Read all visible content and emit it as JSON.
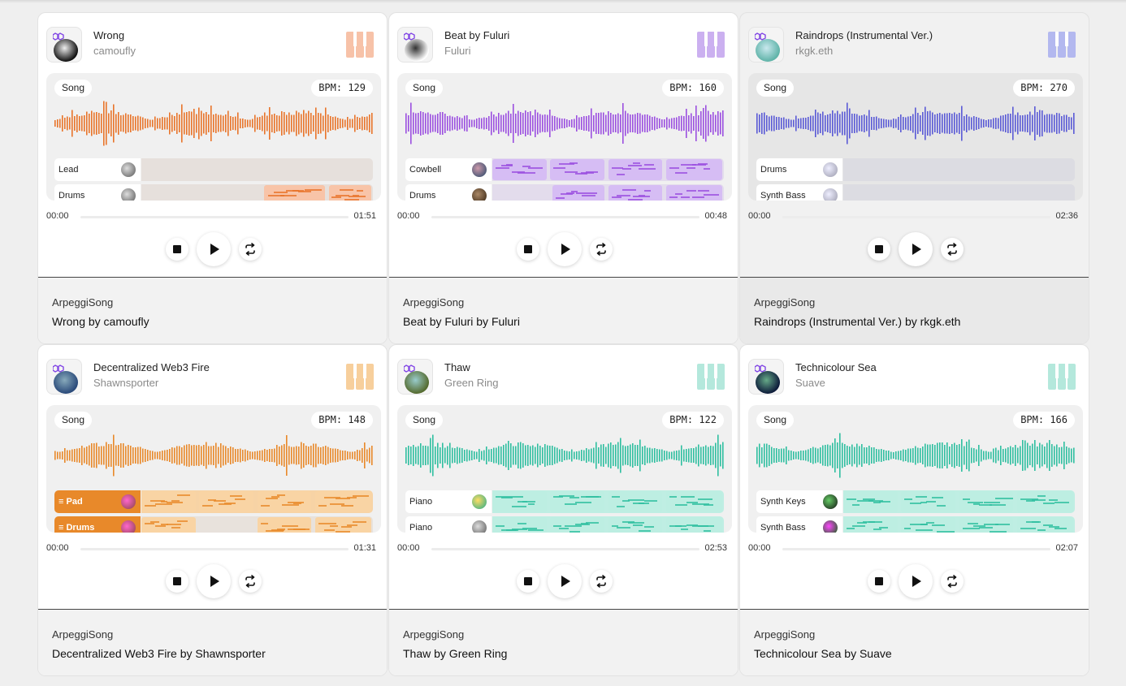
{
  "cards": [
    {
      "title": "Wrong",
      "artist": "camoufly",
      "accent": "#e8742a",
      "keys": "#f7c2a8",
      "badge": "Song",
      "bpm": "BPM: 129",
      "tracks": [
        {
          "name": "Lead",
          "icon": "avatar-gray",
          "lane": "#e6e0dc",
          "clips": []
        },
        {
          "name": "Drums",
          "icon": "avatar-gray",
          "lane": "#e6e0dc",
          "clips": [
            {
              "a": 0.53,
              "b": 0.8,
              "c": "#f8c4a8"
            },
            {
              "a": 0.81,
              "b": 1.0,
              "c": "#f8c4a8"
            }
          ]
        }
      ],
      "current": "00:00",
      "duration": "01:51",
      "kind": "ArpeggiSong",
      "full": "Wrong by camoufly",
      "dim": false,
      "pic": [
        "#111",
        "#eee"
      ]
    },
    {
      "title": "Beat by Fuluri",
      "artist": "Fuluri",
      "accent": "#9b4fe0",
      "keys": "#cbb0f0",
      "badge": "Song",
      "bpm": "BPM: 160",
      "tracks": [
        {
          "name": "Cowbell",
          "icon": "avatar-blue",
          "lane": "#e3dcec",
          "clips": [
            {
              "a": 0.0,
              "b": 0.24,
              "c": "#d6bdf4"
            },
            {
              "a": 0.25,
              "b": 0.49,
              "c": "#d6bdf4"
            },
            {
              "a": 0.5,
              "b": 0.74,
              "c": "#d6bdf4"
            },
            {
              "a": 0.75,
              "b": 1.0,
              "c": "#d6bdf4"
            }
          ]
        },
        {
          "name": "Drums",
          "icon": "avatar-brown",
          "lane": "#e3dcec",
          "clips": [
            {
              "a": 0.26,
              "b": 0.49,
              "c": "#d6bdf4"
            },
            {
              "a": 0.5,
              "b": 0.74,
              "c": "#d6bdf4"
            },
            {
              "a": 0.75,
              "b": 1.0,
              "c": "#d6bdf4"
            }
          ]
        }
      ],
      "current": "00:00",
      "duration": "00:48",
      "kind": "ArpeggiSong",
      "full": "Beat by Fuluri by Fuluri",
      "dim": false,
      "pic": [
        "#fff",
        "#333"
      ]
    },
    {
      "title": "Raindrops (Instrumental Ver.)",
      "artist": "rkgk.eth",
      "accent": "#5a5ad6",
      "keys": "#b3b8ef",
      "badge": "Song",
      "bpm": "BPM: 270",
      "tracks": [
        {
          "name": "Drums",
          "icon": "avatar-mic",
          "lane": "#dcdce2",
          "clips": []
        },
        {
          "name": "Synth Bass",
          "icon": "avatar-mic",
          "lane": "#dcdce2",
          "clips": []
        }
      ],
      "current": "00:00",
      "duration": "02:36",
      "kind": "ArpeggiSong",
      "full": "Raindrops (Instrumental Ver.) by rkgk.eth",
      "dim": true,
      "pic": [
        "#5fb3a8",
        "#c9e8ee"
      ]
    },
    {
      "title": "Decentralized Web3 Fire",
      "artist": "Shawnsporter",
      "accent": "#e8892a",
      "keys": "#f7cf9c",
      "badge": "Song",
      "bpm": "BPM: 148",
      "tracks": [
        {
          "name": "Pad",
          "icon": "avatar-pair",
          "lane": "#f7d3a5",
          "active": true,
          "clips": [
            {
              "a": 0.0,
              "b": 0.24,
              "c": "#f9d4a4"
            },
            {
              "a": 0.25,
              "b": 0.49,
              "c": "#f9d4a4"
            },
            {
              "a": 0.5,
              "b": 0.74,
              "c": "#f9d4a4"
            },
            {
              "a": 0.75,
              "b": 1.0,
              "c": "#f9d4a4"
            }
          ]
        },
        {
          "name": "Drums",
          "icon": "avatar-pair",
          "lane": "#e8e2dc",
          "active": true,
          "clips": [
            {
              "a": 0.0,
              "b": 0.24,
              "c": "#f9d4a4"
            },
            {
              "a": 0.5,
              "b": 0.74,
              "c": "#f9d4a4"
            },
            {
              "a": 0.75,
              "b": 1.0,
              "c": "#f9d4a4"
            }
          ]
        }
      ],
      "current": "00:00",
      "duration": "01:31",
      "kind": "ArpeggiSong",
      "full": "Decentralized Web3 Fire by Shawnsporter",
      "dim": false,
      "pic": [
        "#2a4a7a",
        "#8ab"
      ]
    },
    {
      "title": "Thaw",
      "artist": "Green Ring",
      "accent": "#2fbfa0",
      "keys": "#b4e8dc",
      "badge": "Song",
      "bpm": "BPM: 122",
      "tracks": [
        {
          "name": "Piano",
          "icon": "avatar-teal",
          "lane": "#bfeee3",
          "clips": [
            {
              "a": 0.0,
              "b": 0.24,
              "c": "#bdeee2"
            },
            {
              "a": 0.25,
              "b": 0.49,
              "c": "#bdeee2"
            },
            {
              "a": 0.5,
              "b": 0.74,
              "c": "#bdeee2"
            },
            {
              "a": 0.75,
              "b": 1.0,
              "c": "#bdeee2"
            }
          ]
        },
        {
          "name": "Piano",
          "icon": "avatar-gray",
          "lane": "#bfeee3",
          "clips": [
            {
              "a": 0.0,
              "b": 0.24,
              "c": "#bdeee2"
            },
            {
              "a": 0.25,
              "b": 0.49,
              "c": "#bdeee2"
            },
            {
              "a": 0.5,
              "b": 0.74,
              "c": "#bdeee2"
            },
            {
              "a": 0.75,
              "b": 1.0,
              "c": "#bdeee2"
            }
          ]
        }
      ],
      "current": "00:00",
      "duration": "02:53",
      "kind": "ArpeggiSong",
      "full": "Thaw by Green Ring",
      "dim": false,
      "pic": [
        "#556b2f",
        "#9cc"
      ]
    },
    {
      "title": "Technicolour Sea",
      "artist": "Suave",
      "accent": "#2fbfa0",
      "keys": "#b4e8dc",
      "badge": "Song",
      "bpm": "BPM: 166",
      "tracks": [
        {
          "name": "Synth Keys",
          "icon": "avatar-dark",
          "lane": "#bfeee3",
          "clips": [
            {
              "a": 0.0,
              "b": 0.24,
              "c": "#bdeee2"
            },
            {
              "a": 0.25,
              "b": 0.49,
              "c": "#bdeee2"
            },
            {
              "a": 0.5,
              "b": 0.74,
              "c": "#bdeee2"
            },
            {
              "a": 0.75,
              "b": 1.0,
              "c": "#bdeee2"
            }
          ]
        },
        {
          "name": "Synth Bass",
          "icon": "avatar-magenta",
          "lane": "#bfeee3",
          "clips": [
            {
              "a": 0.0,
              "b": 0.24,
              "c": "#bdeee2"
            },
            {
              "a": 0.25,
              "b": 0.49,
              "c": "#bdeee2"
            },
            {
              "a": 0.5,
              "b": 0.74,
              "c": "#bdeee2"
            },
            {
              "a": 0.75,
              "b": 1.0,
              "c": "#bdeee2"
            }
          ]
        }
      ],
      "current": "00:00",
      "duration": "02:07",
      "kind": "ArpeggiSong",
      "full": "Technicolour Sea by Suave",
      "dim": false,
      "pic": [
        "#0d1b3a",
        "#6a8"
      ]
    }
  ]
}
